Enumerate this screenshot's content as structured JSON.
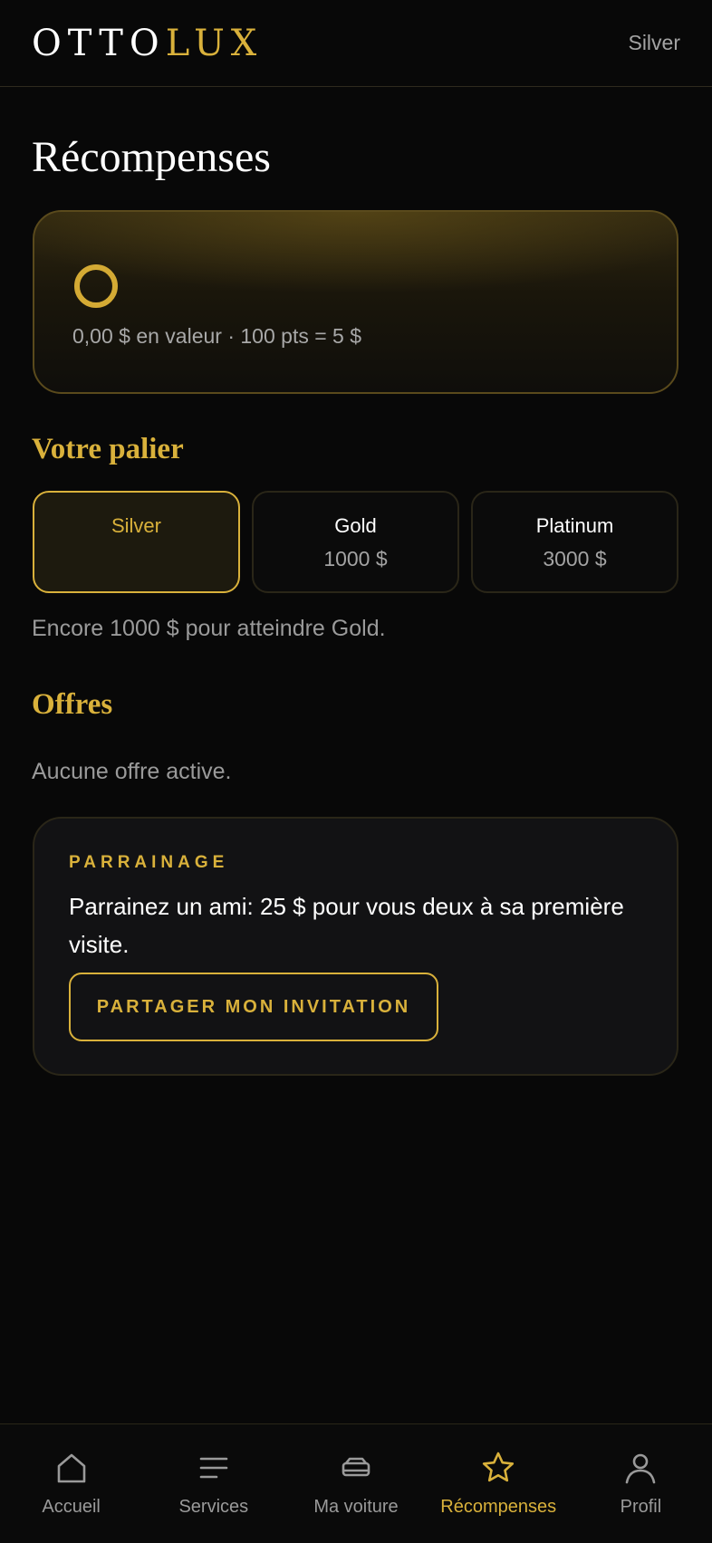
{
  "header": {
    "logo_part1": "OTTO",
    "logo_part2": "LUX",
    "tier_badge": "Silver"
  },
  "page_title": "Récompenses",
  "points_card": {
    "value_text": "0,00 $ en valeur · 100 pts = 5 $"
  },
  "tier_section": {
    "title": "Votre palier",
    "tiers": [
      {
        "name": "Silver",
        "price": "",
        "active": true
      },
      {
        "name": "Gold",
        "price": "1000 $",
        "active": false
      },
      {
        "name": "Platinum",
        "price": "3000 $",
        "active": false
      }
    ],
    "hint": "Encore 1000 $ pour atteindre Gold."
  },
  "offers_section": {
    "title": "Offres",
    "empty_text": "Aucune offre active."
  },
  "referral": {
    "label": "PARRAINAGE",
    "text": "Parrainez un ami: 25 $ pour vous deux à sa première visite.",
    "button": "PARTAGER MON INVITATION"
  },
  "bottom_nav": {
    "items": [
      {
        "label": "Accueil",
        "icon": "home-icon"
      },
      {
        "label": "Services",
        "icon": "menu-icon"
      },
      {
        "label": "Ma voiture",
        "icon": "car-icon"
      },
      {
        "label": "Récompenses",
        "icon": "star-icon",
        "active": true
      },
      {
        "label": "Profil",
        "icon": "user-icon"
      }
    ]
  },
  "colors": {
    "accent": "#d9b13b",
    "background": "#080808",
    "muted_text": "#9a9a9a"
  }
}
